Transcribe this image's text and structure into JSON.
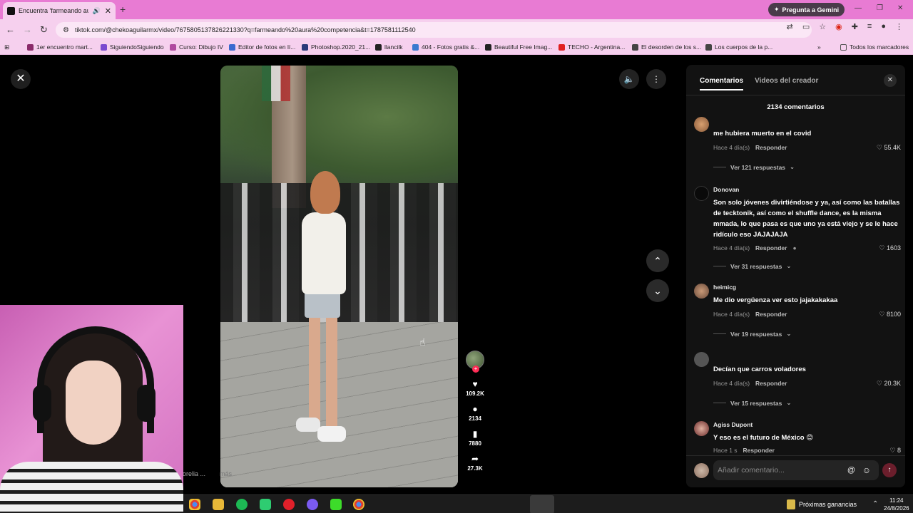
{
  "browser": {
    "tab_title": "Encuentra 'farmeando aura",
    "url": "tiktok.com/@chekoaguilarmx/video/7675805137826221330?q=farmeando%20aura%20competencia&t=1787581112540",
    "gemini_label": "Pregunta a Gemini",
    "bookmarks": [
      "1er encuentro mart...",
      "SiguiendoSiguiendo",
      "Curso: Dibujo IV",
      "Editor de fotos en lí...",
      "Photoshop.2020_21...",
      "llancilk",
      "404 - Fotos gratis &...",
      "Beautiful Free Imag...",
      "TECHO - Argentina...",
      "El desorden de los s...",
      "Los cuerpos de la p..."
    ],
    "bookmarks_folder": "Todos los marcadores"
  },
  "video": {
    "caption_left": "orelia ...",
    "caption_more": "más",
    "likes": "109.2K",
    "comments": "2134",
    "saves": "7880",
    "shares": "27.3K"
  },
  "panel": {
    "tab_comments": "Comentarios",
    "tab_creator": "Videos del creador",
    "count_label": "2134 comentarios",
    "reply_label": "Responder",
    "input_placeholder": "Añadir comentario...",
    "comments": [
      {
        "user": "",
        "text": "me hubiera muerto en el covid",
        "date": "Hace 4 día(s)",
        "likes": "55.4K",
        "more": "Ver 121 respuestas"
      },
      {
        "user": "Donovan",
        "text": "Son solo jóvenes divirtiéndose y ya, así como las batallas de tecktonik, así como el shuffle dance, es la misma mmada, lo que pasa es que uno ya está viejo y se le hace ridículo eso JAJAJAJA",
        "date": "Hace 4 día(s)",
        "likes": "1603",
        "more": "Ver 31 respuestas"
      },
      {
        "user": "heimicg",
        "text": "Me dio vergüenza ver esto jajakakakaa",
        "date": "Hace 4 día(s)",
        "likes": "8100",
        "more": "Ver 19 respuestas"
      },
      {
        "user": "",
        "text": "Decían que carros voladores",
        "date": "Hace 4 día(s)",
        "likes": "20.3K",
        "more": "Ver 15 respuestas"
      },
      {
        "user": "Agiss Dupont",
        "text": "Y eso es el futuro de México 😊",
        "date": "Hace 1 s",
        "likes": "8",
        "more": ""
      }
    ]
  },
  "taskbar": {
    "weather": "Próximas ganancias",
    "time": "11:24",
    "date": "24/8/2026"
  },
  "colors": {
    "tabbar": "#e87bd3",
    "panel_bg": "#121212",
    "like_accent": "#fe2c55"
  }
}
